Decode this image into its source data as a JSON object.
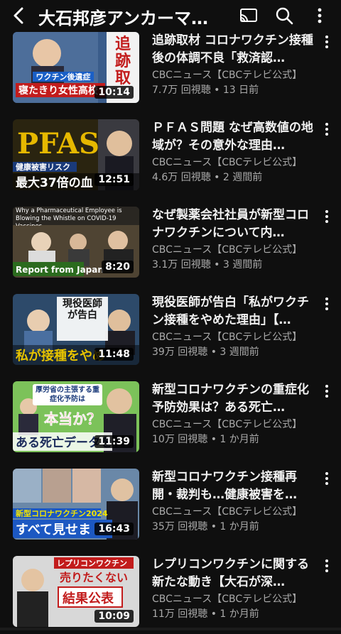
{
  "header": {
    "title": "大石邦彦アンカーマ…",
    "icons": [
      "back-arrow-icon",
      "cast-icon",
      "search-icon",
      "more-vert-icon"
    ]
  },
  "videos": [
    {
      "title": "追跡取材 コロナワクチン接種後の体調不良「救済認…",
      "channel": "CBCニュース【CBCテレビ公式】",
      "stats": "7.7万 回視聴 • 13 日前",
      "duration": "10:14",
      "thumb": {
        "main_text": "寝たきり女性高校",
        "sub_text": "ワクチン後遺症",
        "side_text": "追跡取",
        "bg": "#3a5c8a",
        "accent": "#c21c1c"
      }
    },
    {
      "title": "ＰＦＡＳ問題 なぜ高数値の地域が？その意外な理由…",
      "channel": "CBCニュース【CBCテレビ公式】",
      "stats": "4.6万 回視聴 • 2 週間前",
      "duration": "12:51",
      "thumb": {
        "main_text": "PFAS",
        "sub_text": "健康被害リスク",
        "side_text": "最大37倍の血",
        "bg": "#2a2410",
        "accent": "#e6b800"
      }
    },
    {
      "title": "なぜ製薬会社社員が新型コロナワクチンについて内…",
      "channel": "CBCニュース【CBCテレビ公式】",
      "stats": "3.1万 回視聴 • 3 週間前",
      "duration": "8:20",
      "thumb": {
        "main_text": "Report from Japan",
        "sub_text": "Why a Pharmaceutical Employee is Blowing the Whistle on COVID-19 Vaccines",
        "side_text": "",
        "bg": "#4f4433",
        "accent": "#2b6b1e"
      }
    },
    {
      "title": "現役医師が告白「私がワクチン接種をやめた理由」【…",
      "channel": "CBCニュース【CBCテレビ公式】",
      "stats": "39万 回視聴 • 3 週間前",
      "duration": "11:48",
      "thumb": {
        "main_text": "私が接種をやめ",
        "sub_text": "現役医師が告白",
        "side_text": "",
        "bg": "#2d4a6a",
        "accent": "#e6c200"
      }
    },
    {
      "title": "新型コロナワクチンの重症化予防効果は？ある死亡…",
      "channel": "CBCニュース【CBCテレビ公式】",
      "stats": "10万 回視聴 • 1 か月前",
      "duration": "11:39",
      "thumb": {
        "main_text": "ある死亡データを",
        "sub_text": "厚労省の主張する重症化予防は",
        "side_text": "本当か？",
        "bg": "#7cc25a",
        "accent": "#d41c1c"
      }
    },
    {
      "title": "新型コロナワクチン接種再開・裁判も…健康被害を…",
      "channel": "CBCニュース【CBCテレビ公式】",
      "stats": "35万 回視聴 • 1 か月前",
      "duration": "16:43",
      "thumb": {
        "main_text": "すべて見せま",
        "sub_text": "新型コロナワクチン2024",
        "side_text": "",
        "bg": "#6a88a8",
        "accent": "#1c58c2"
      }
    },
    {
      "title": "レプリコンワクチンに関する新たな動き【大石が深…",
      "channel": "CBCニュース【CBCテレビ公式】",
      "stats": "11万 回視聴 • 1 か月前",
      "duration": "10:09",
      "thumb": {
        "main_text": "結果公表",
        "sub_text": "売りたくない",
        "side_text": "レプリコンワクチン",
        "bg": "#d8d8d8",
        "accent": "#c21c1c"
      }
    }
  ]
}
